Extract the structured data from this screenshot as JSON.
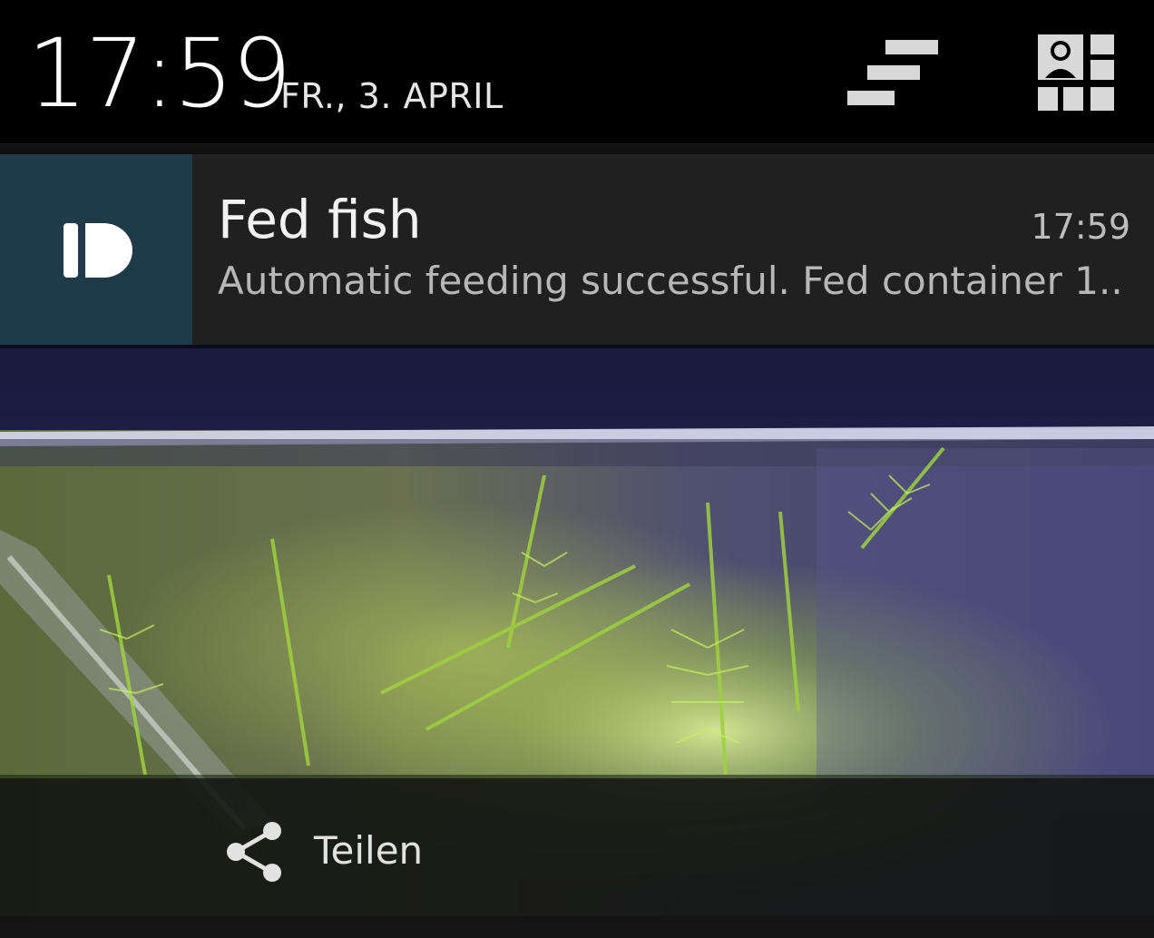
{
  "status_header": {
    "time": "17:59",
    "date": "FR., 3. APRIL",
    "icons": [
      "settings-toggle-icon",
      "quick-settings-icon"
    ]
  },
  "notification": {
    "app_icon": "app-logo-icon",
    "title": "Fed fish",
    "time": "17:59",
    "text": "Automatic feeding successful. Fed container 1..",
    "icon_tile_color": "#1f3a48"
  },
  "big_picture": {
    "subject": "aquarium-camera-image"
  },
  "actions": [
    {
      "icon": "share-icon",
      "label": "Teilen"
    }
  ],
  "colors": {
    "header_bg": "#000000",
    "notification_bg": "#202020",
    "action_bar_bg": "#121212"
  }
}
